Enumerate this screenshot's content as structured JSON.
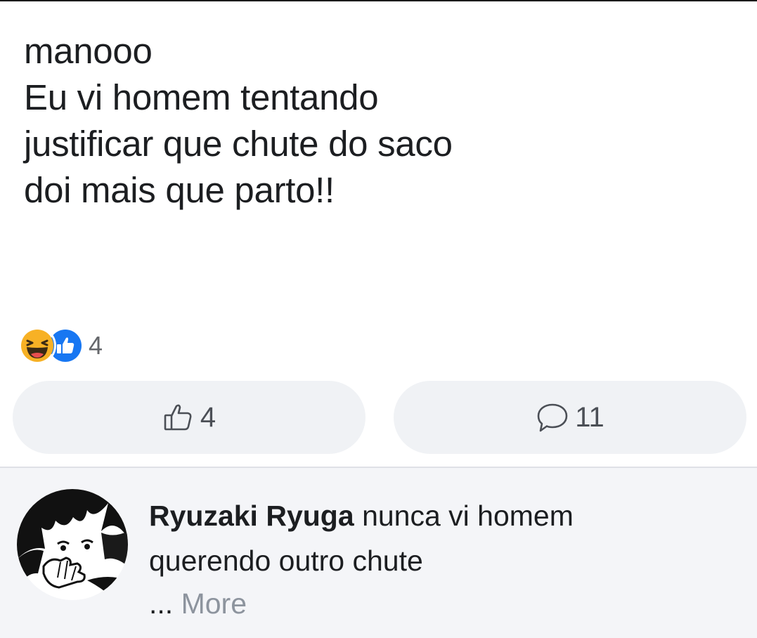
{
  "post": {
    "lines": [
      "manooo",
      "Eu vi homem tentando",
      "justificar que chute do saco",
      "doi mais que parto!!"
    ]
  },
  "reactions": {
    "count": "4",
    "types": [
      "haha-icon",
      "like-icon"
    ]
  },
  "actions": {
    "like_count": "4",
    "comment_count": "11"
  },
  "comment": {
    "author": "Ryuzaki Ryuga",
    "text_line1": "nunca vi homem",
    "text_line2": "querendo outro chute",
    "ellipsis": "...",
    "more_label": "More"
  },
  "colors": {
    "like_blue": "#1877f2",
    "haha_yellow": "#f7b125",
    "button_bg": "#f0f2f5",
    "muted_text": "#65676b"
  }
}
